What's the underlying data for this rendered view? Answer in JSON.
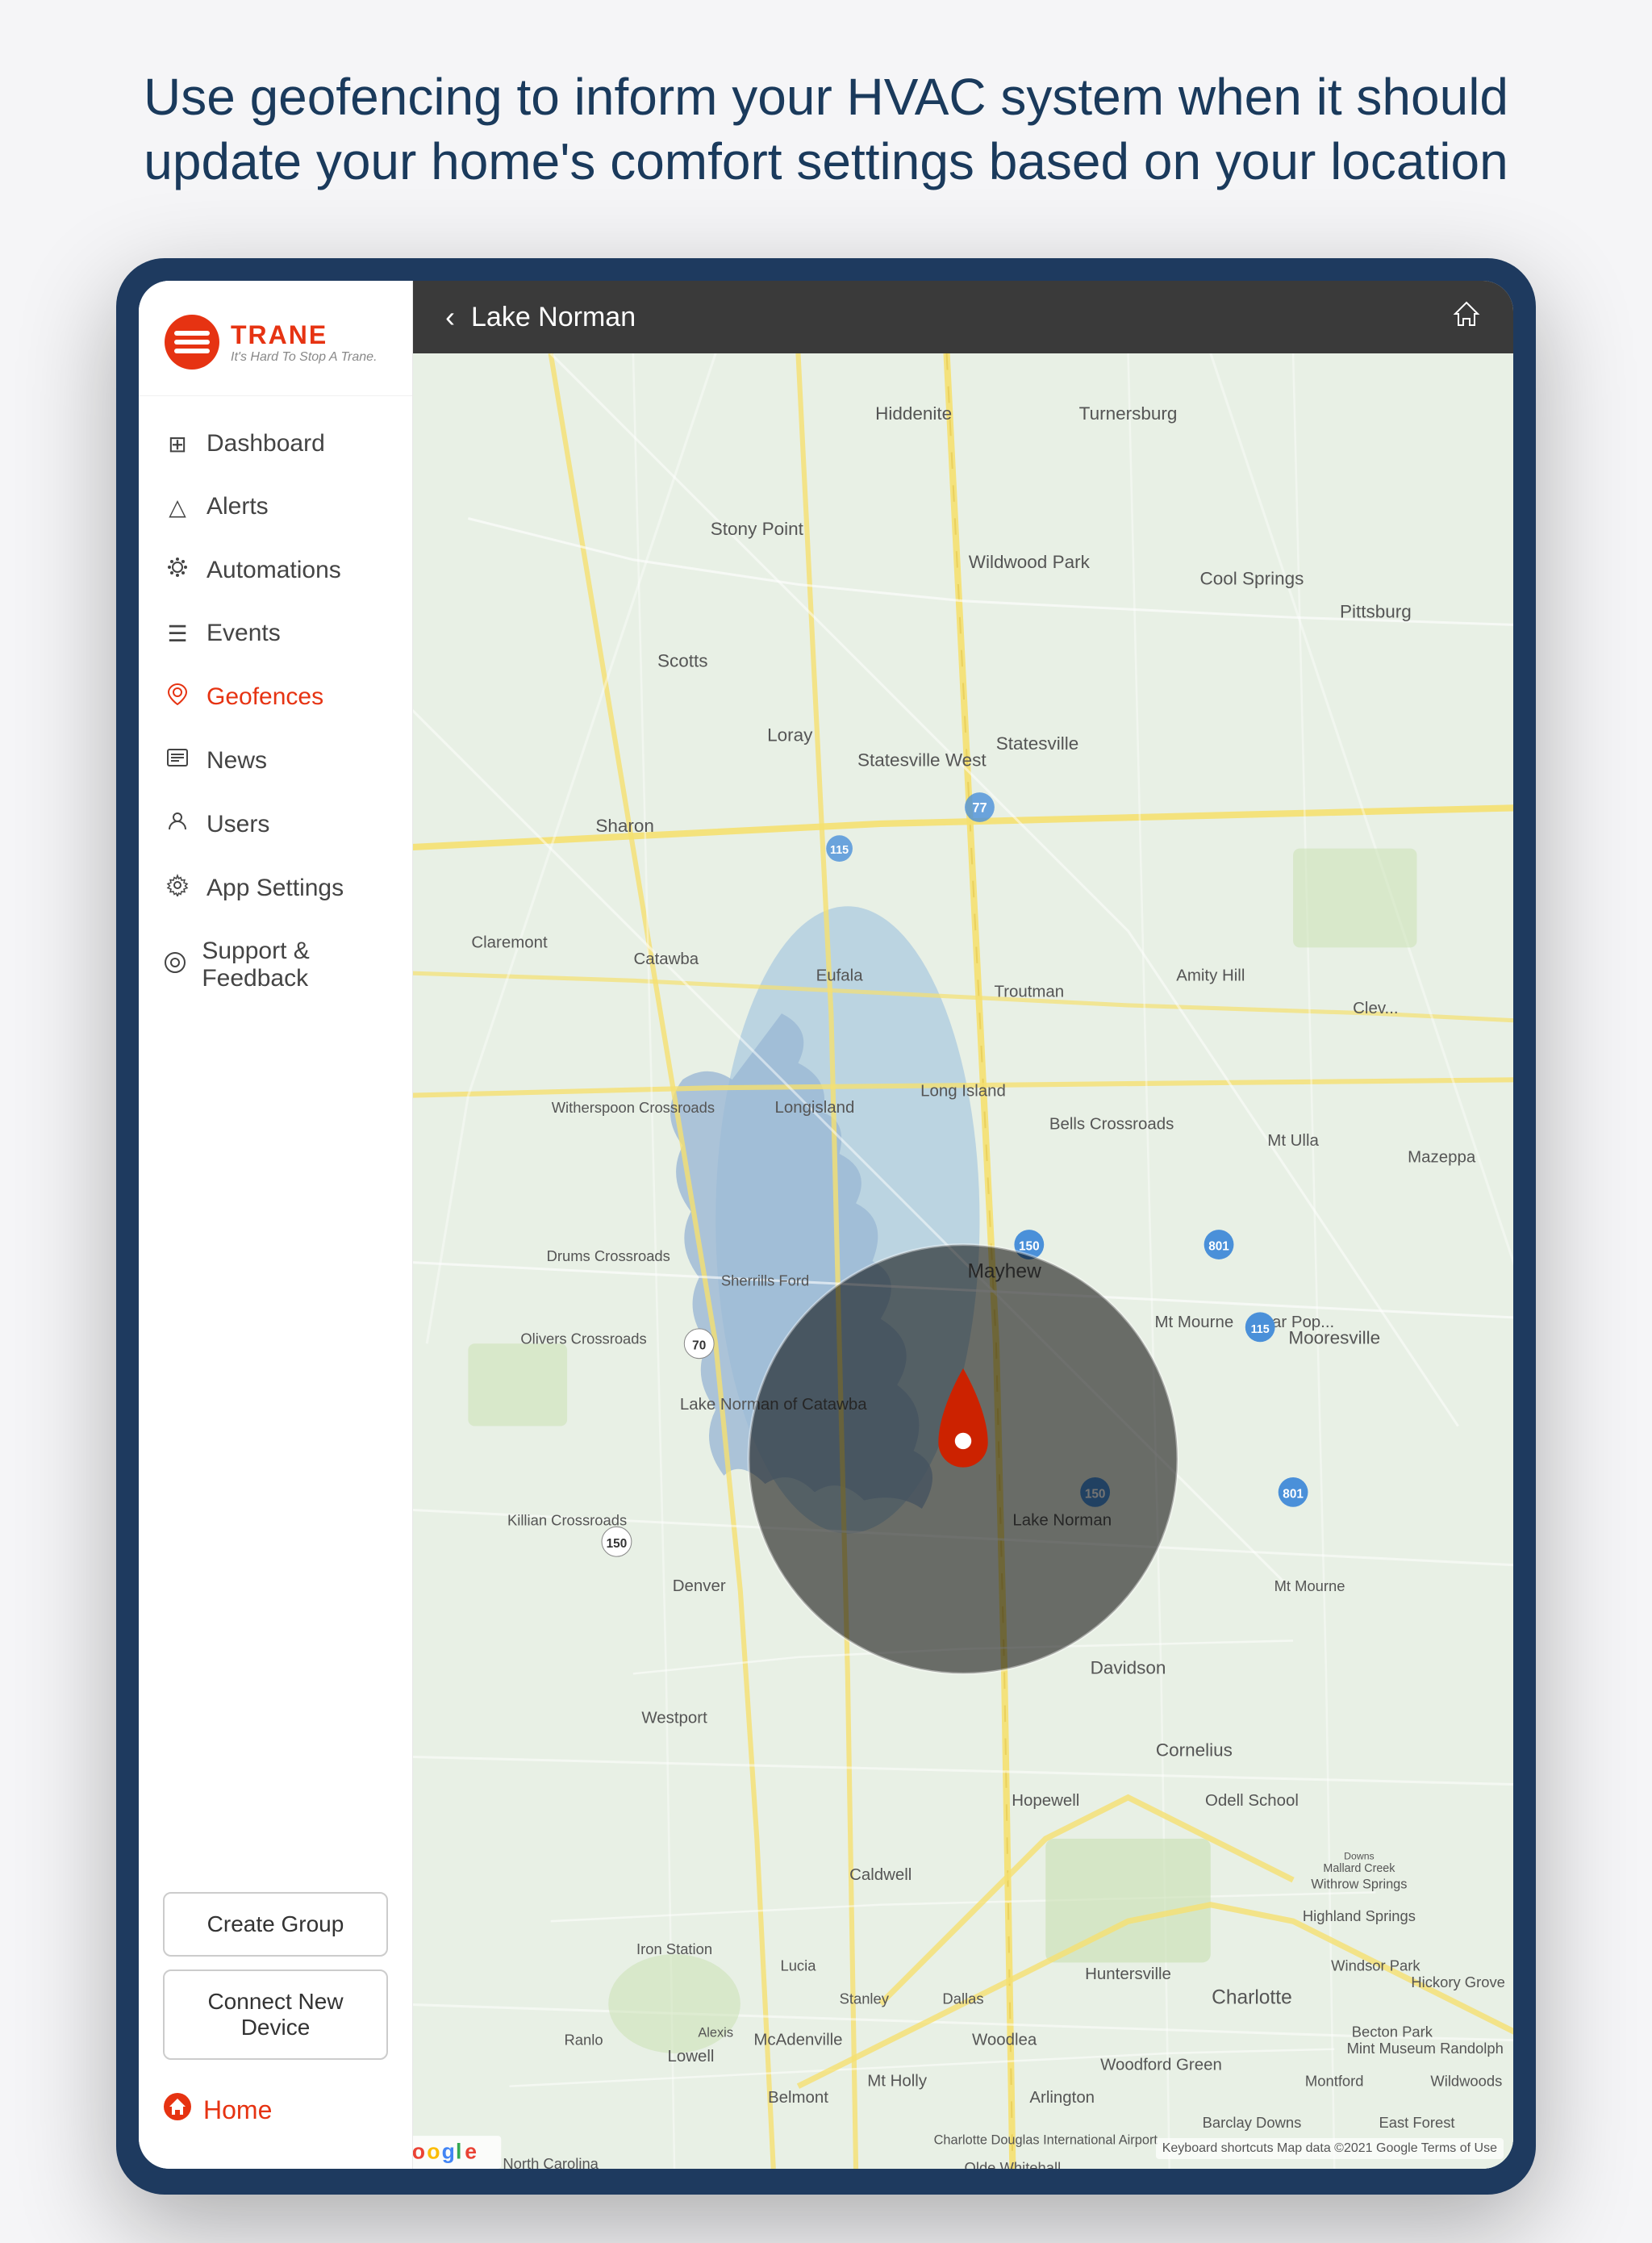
{
  "headline": "Use geofencing to inform your HVAC system when it should update your home's comfort settings based on your location",
  "brand": {
    "name": "TRANE",
    "tagline": "It's Hard To Stop A Trane."
  },
  "topbar": {
    "title": "Lake Norman",
    "back_label": "‹",
    "home_icon": "⌂"
  },
  "nav": {
    "items": [
      {
        "id": "dashboard",
        "label": "Dashboard",
        "icon": "⊞",
        "active": false
      },
      {
        "id": "alerts",
        "label": "Alerts",
        "icon": "△",
        "active": false
      },
      {
        "id": "automations",
        "label": "Automations",
        "icon": "⚙",
        "active": false
      },
      {
        "id": "events",
        "label": "Events",
        "icon": "☰",
        "active": false
      },
      {
        "id": "geofences",
        "label": "Geofences",
        "icon": "☺",
        "active": true
      },
      {
        "id": "news",
        "label": "News",
        "icon": "🗞",
        "active": false
      },
      {
        "id": "users",
        "label": "Users",
        "icon": "☺",
        "active": false
      },
      {
        "id": "app-settings",
        "label": "App Settings",
        "icon": "⚙",
        "active": false
      },
      {
        "id": "support-feedback",
        "label": "Support & Feedback",
        "icon": "◎",
        "active": false
      }
    ]
  },
  "buttons": {
    "create_group": "Create Group",
    "connect_device": "Connect New Device"
  },
  "home": {
    "label": "Home",
    "icon": "⌂"
  },
  "map": {
    "attribution": "Google",
    "copyright": "Keyboard shortcuts  Map data ©2021 Google  Terms of Use"
  }
}
